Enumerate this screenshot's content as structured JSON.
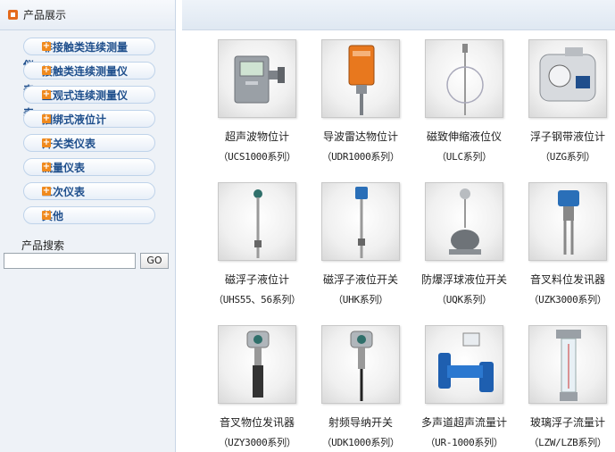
{
  "sidebar": {
    "title": "产品展示",
    "side_chars": [
      "仪",
      "表",
      "表"
    ],
    "items": [
      {
        "label": "非接触类连续测量"
      },
      {
        "label": "接触类连续测量仪"
      },
      {
        "label": "直观式连续测量仪"
      },
      {
        "label": "捆绑式液位计"
      },
      {
        "label": "开关类仪表"
      },
      {
        "label": "流量仪表"
      },
      {
        "label": "二次仪表"
      },
      {
        "label": "其他"
      }
    ],
    "search": {
      "label": "产品搜索",
      "value": "",
      "button": "GO"
    }
  },
  "products": [
    {
      "name": "超声波物位计",
      "model": "（UCS1000系列）",
      "icon": "ultrasonic-level-meter"
    },
    {
      "name": "导波雷达物位计",
      "model": "（UDR1000系列）",
      "icon": "guided-radar-level-meter"
    },
    {
      "name": "磁致伸缩液位仪",
      "model": "（ULC系列）",
      "icon": "magnetostrictive-level-gauge"
    },
    {
      "name": "浮子钢带液位计",
      "model": "（UZG系列）",
      "icon": "float-steel-tape-level-gauge"
    },
    {
      "name": "磁浮子液位计",
      "model": "（UHS55、56系列）",
      "icon": "magnetic-float-level-gauge"
    },
    {
      "name": "磁浮子液位开关",
      "model": "（UHK系列）",
      "icon": "magnetic-float-level-switch"
    },
    {
      "name": "防爆浮球液位开关",
      "model": "（UQK系列）",
      "icon": "explosion-proof-float-switch"
    },
    {
      "name": "音叉料位发讯器",
      "model": "（UZK3000系列）",
      "icon": "tuning-fork-material-level"
    },
    {
      "name": "音叉物位发讯器",
      "model": "（UZY3000系列）",
      "icon": "tuning-fork-level"
    },
    {
      "name": "射频导纳开关",
      "model": "（UDK1000系列）",
      "icon": "rf-admittance-switch"
    },
    {
      "name": "多声道超声流量计",
      "model": "（UR-1000系列）",
      "icon": "multichannel-ultrasonic-flowmeter"
    },
    {
      "name": "玻璃浮子流量计",
      "model": "（LZW/LZB系列）",
      "icon": "glass-rotameter"
    }
  ]
}
